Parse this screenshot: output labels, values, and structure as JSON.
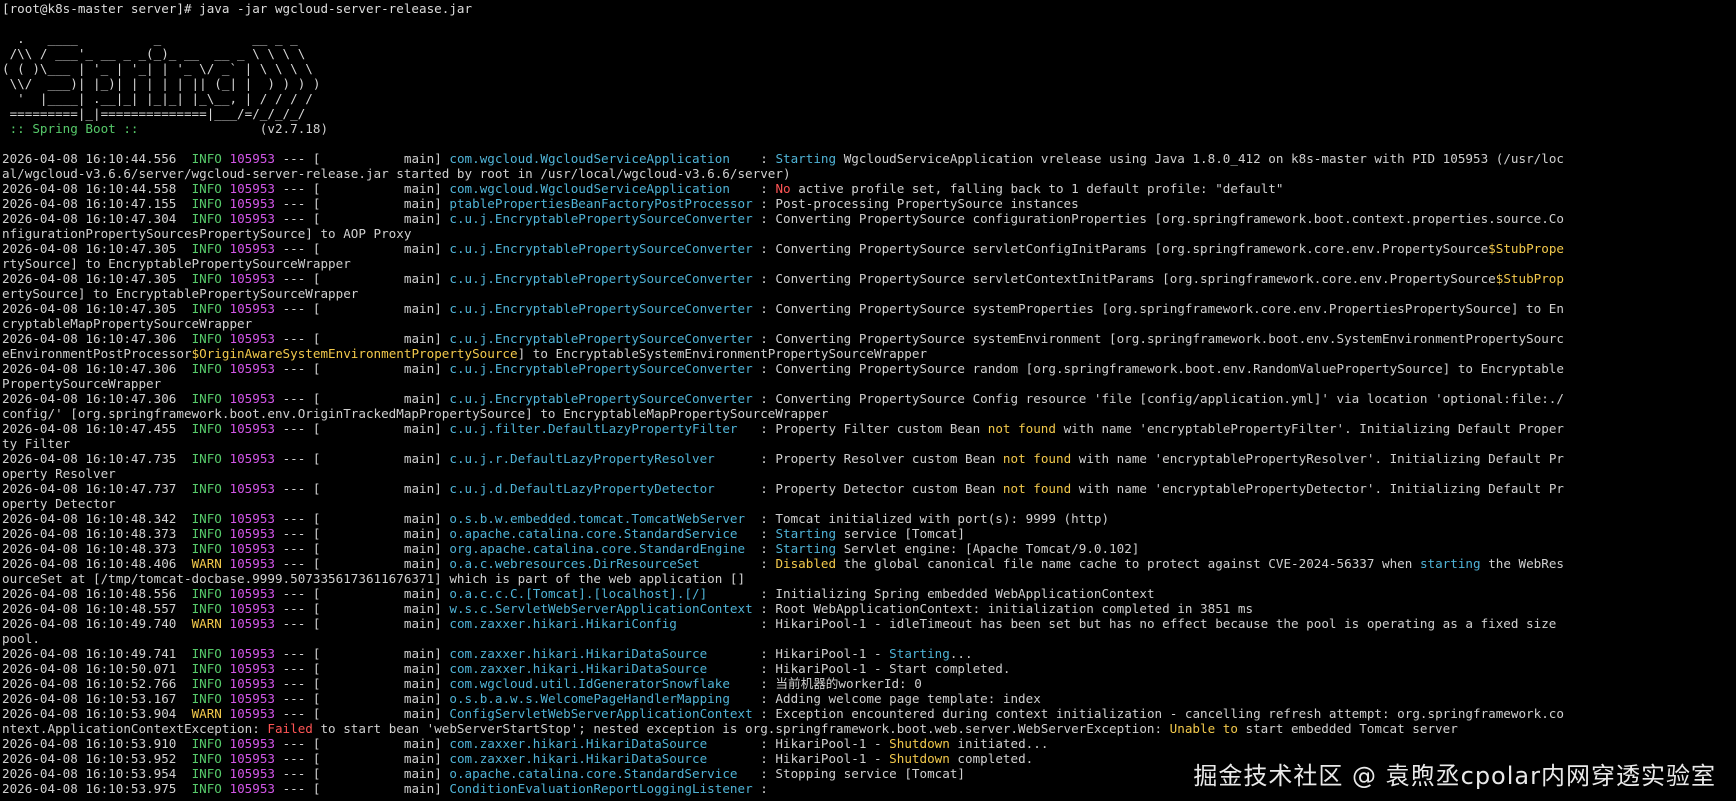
{
  "prompt": "[root@k8s-master server]# java -jar wgcloud-server-release.jar",
  "banner": [
    "  .   ____          _            __ _ _",
    " /\\\\ / ___'_ __ _ _(_)_ __  __ _ \\ \\ \\ \\",
    "( ( )\\___ | '_ | '_| | '_ \\/ _` | \\ \\ \\ \\",
    " \\\\/  ___)| |_)| | | | | || (_| |  ) ) ) )",
    "  '  |____| .__|_| |_|_| |_\\__, | / / / /",
    " =========|_|==============|___/=/_/_/_/"
  ],
  "spring_boot": {
    "label": " :: Spring Boot :: ",
    "version": "               (v2.7.18)"
  },
  "logs": [
    {
      "ts": "2026-04-08 16:10:44.556",
      "lvl": "INFO",
      "pid": "105953",
      "thread": " --- [           main] ",
      "logger": "com.wgcloud.WgcloudServiceApplication    ",
      "msg": [
        {
          "t": ": "
        },
        {
          "t": "Starting",
          "c": "cyan"
        },
        {
          "t": " WgcloudServiceApplication vrelease using Java 1.8.0_412 on k8s-master with PID 105953 (/usr/loc"
        }
      ],
      "cont": "al/wgcloud-v3.6.6/server/wgcloud-server-release.jar started by root in /usr/local/wgcloud-v3.6.6/server)"
    },
    {
      "ts": "2026-04-08 16:10:44.558",
      "lvl": "INFO",
      "pid": "105953",
      "thread": " --- [           main] ",
      "logger": "com.wgcloud.WgcloudServiceApplication    ",
      "msg": [
        {
          "t": ": "
        },
        {
          "t": "No",
          "c": "red"
        },
        {
          "t": " active profile set, falling back to 1 default profile: \"default\""
        }
      ]
    },
    {
      "ts": "2026-04-08 16:10:47.155",
      "lvl": "INFO",
      "pid": "105953",
      "thread": " --- [           main] ",
      "logger": "ptablePropertiesBeanFactoryPostProcessor ",
      "msg": [
        {
          "t": ": Post-processing PropertySource instances"
        }
      ]
    },
    {
      "ts": "2026-04-08 16:10:47.304",
      "lvl": "INFO",
      "pid": "105953",
      "thread": " --- [           main] ",
      "logger": "c.u.j.EncryptablePropertySourceConverter ",
      "msg": [
        {
          "t": ": Converting PropertySource configurationProperties [org.springframework.boot.context.properties.source.Co"
        }
      ],
      "cont": "nfigurationPropertySourcesPropertySource] to AOP Proxy"
    },
    {
      "ts": "2026-04-08 16:10:47.305",
      "lvl": "INFO",
      "pid": "105953",
      "thread": " --- [           main] ",
      "logger": "c.u.j.EncryptablePropertySourceConverter ",
      "msg": [
        {
          "t": ": Converting PropertySource servletConfigInitParams [org.springframework.core.env.PropertySource"
        },
        {
          "t": "$StubPrope",
          "c": "yel"
        }
      ],
      "cont": "rtySource] to EncryptablePropertySourceWrapper"
    },
    {
      "ts": "2026-04-08 16:10:47.305",
      "lvl": "INFO",
      "pid": "105953",
      "thread": " --- [           main] ",
      "logger": "c.u.j.EncryptablePropertySourceConverter ",
      "msg": [
        {
          "t": ": Converting PropertySource servletContextInitParams [org.springframework.core.env.PropertySource"
        },
        {
          "t": "$StubProp",
          "c": "yel"
        }
      ],
      "cont": "ertySource] to EncryptablePropertySourceWrapper"
    },
    {
      "ts": "2026-04-08 16:10:47.305",
      "lvl": "INFO",
      "pid": "105953",
      "thread": " --- [           main] ",
      "logger": "c.u.j.EncryptablePropertySourceConverter ",
      "msg": [
        {
          "t": ": Converting PropertySource systemProperties [org.springframework.core.env.PropertiesPropertySource] to En"
        }
      ],
      "cont": "cryptableMapPropertySourceWrapper"
    },
    {
      "ts": "2026-04-08 16:10:47.306",
      "lvl": "INFO",
      "pid": "105953",
      "thread": " --- [           main] ",
      "logger": "c.u.j.EncryptablePropertySourceConverter ",
      "msg": [
        {
          "t": ": Converting PropertySource systemEnvironment [org.springframework.boot.env.SystemEnvironmentPropertySourc"
        }
      ],
      "contParts": [
        {
          "t": "eEnvironmentPostProcessor"
        },
        {
          "t": "$OriginAwareSystemEnvironmentPropertySource",
          "c": "yel"
        },
        {
          "t": "] to EncryptableSystemEnvironmentPropertySourceWrapper"
        }
      ]
    },
    {
      "ts": "2026-04-08 16:10:47.306",
      "lvl": "INFO",
      "pid": "105953",
      "thread": " --- [           main] ",
      "logger": "c.u.j.EncryptablePropertySourceConverter ",
      "msg": [
        {
          "t": ": Converting PropertySource random [org.springframework.boot.env.RandomValuePropertySource] to Encryptable"
        }
      ],
      "cont": "PropertySourceWrapper"
    },
    {
      "ts": "2026-04-08 16:10:47.306",
      "lvl": "INFO",
      "pid": "105953",
      "thread": " --- [           main] ",
      "logger": "c.u.j.EncryptablePropertySourceConverter ",
      "msg": [
        {
          "t": ": Converting PropertySource Config resource 'file [config/application.yml]' via location 'optional:file:./"
        }
      ],
      "cont": "config/' [org.springframework.boot.env.OriginTrackedMapPropertySource] to EncryptableMapPropertySourceWrapper"
    },
    {
      "ts": "2026-04-08 16:10:47.455",
      "lvl": "INFO",
      "pid": "105953",
      "thread": " --- [           main] ",
      "logger": "c.u.j.filter.DefaultLazyPropertyFilter   ",
      "msg": [
        {
          "t": ": Property Filter custom Bean "
        },
        {
          "t": "not found",
          "c": "yel"
        },
        {
          "t": " with name 'encryptablePropertyFilter'. Initializing Default Proper"
        }
      ],
      "cont": "ty Filter"
    },
    {
      "ts": "2026-04-08 16:10:47.735",
      "lvl": "INFO",
      "pid": "105953",
      "thread": " --- [           main] ",
      "logger": "c.u.j.r.DefaultLazyPropertyResolver      ",
      "msg": [
        {
          "t": ": Property Resolver custom Bean "
        },
        {
          "t": "not found",
          "c": "yel"
        },
        {
          "t": " with name 'encryptablePropertyResolver'. Initializing Default Pr"
        }
      ],
      "cont": "operty Resolver"
    },
    {
      "ts": "2026-04-08 16:10:47.737",
      "lvl": "INFO",
      "pid": "105953",
      "thread": " --- [           main] ",
      "logger": "c.u.j.d.DefaultLazyPropertyDetector      ",
      "msg": [
        {
          "t": ": Property Detector custom Bean "
        },
        {
          "t": "not found",
          "c": "yel"
        },
        {
          "t": " with name 'encryptablePropertyDetector'. Initializing Default Pr"
        }
      ],
      "cont": "operty Detector"
    },
    {
      "ts": "2026-04-08 16:10:48.342",
      "lvl": "INFO",
      "pid": "105953",
      "thread": " --- [           main] ",
      "logger": "o.s.b.w.embedded.tomcat.TomcatWebServer  ",
      "msg": [
        {
          "t": ": Tomcat initialized with port(s): 9999 (http)"
        }
      ]
    },
    {
      "ts": "2026-04-08 16:10:48.373",
      "lvl": "INFO",
      "pid": "105953",
      "thread": " --- [           main] ",
      "logger": "o.apache.catalina.core.StandardService   ",
      "msg": [
        {
          "t": ": "
        },
        {
          "t": "Starting",
          "c": "cyan"
        },
        {
          "t": " service [Tomcat]"
        }
      ]
    },
    {
      "ts": "2026-04-08 16:10:48.373",
      "lvl": "INFO",
      "pid": "105953",
      "thread": " --- [           main] ",
      "logger": "org.apache.catalina.core.StandardEngine  ",
      "msg": [
        {
          "t": ": "
        },
        {
          "t": "Starting",
          "c": "cyan"
        },
        {
          "t": " Servlet engine: [Apache Tomcat/9.0.102]"
        }
      ]
    },
    {
      "ts": "2026-04-08 16:10:48.406",
      "lvl": "WARN",
      "pid": "105953",
      "thread": " --- [           main] ",
      "logger": "o.a.c.webresources.DirResourceSet        ",
      "msg": [
        {
          "t": ": "
        },
        {
          "t": "Disabled",
          "c": "yel"
        },
        {
          "t": " the global canonical file name cache to protect against CVE-2024-56337 when "
        },
        {
          "t": "starting",
          "c": "cyan"
        },
        {
          "t": " the WebRes"
        }
      ],
      "cont": "ourceSet at [/tmp/tomcat-docbase.9999.5073356173611676371] which is part of the web application []"
    },
    {
      "ts": "2026-04-08 16:10:48.556",
      "lvl": "INFO",
      "pid": "105953",
      "thread": " --- [           main] ",
      "logger": "o.a.c.c.C.[Tomcat].[localhost].[/]       ",
      "msg": [
        {
          "t": ": Initializing Spring embedded WebApplicationContext"
        }
      ]
    },
    {
      "ts": "2026-04-08 16:10:48.557",
      "lvl": "INFO",
      "pid": "105953",
      "thread": " --- [           main] ",
      "logger": "w.s.c.ServletWebServerApplicationContext ",
      "msg": [
        {
          "t": ": Root WebApplicationContext: initialization completed in 3851 ms"
        }
      ]
    },
    {
      "ts": "2026-04-08 16:10:49.740",
      "lvl": "WARN",
      "pid": "105953",
      "thread": " --- [           main] ",
      "logger": "com.zaxxer.hikari.HikariConfig           ",
      "msg": [
        {
          "t": ": HikariPool-1 - idleTimeout has been set but has no effect because the pool is operating as a fixed size"
        }
      ],
      "cont": "pool."
    },
    {
      "ts": "2026-04-08 16:10:49.741",
      "lvl": "INFO",
      "pid": "105953",
      "thread": " --- [           main] ",
      "logger": "com.zaxxer.hikari.HikariDataSource       ",
      "msg": [
        {
          "t": ": HikariPool-1 - "
        },
        {
          "t": "Starting",
          "c": "cyan"
        },
        {
          "t": "..."
        }
      ]
    },
    {
      "ts": "2026-04-08 16:10:50.071",
      "lvl": "INFO",
      "pid": "105953",
      "thread": " --- [           main] ",
      "logger": "com.zaxxer.hikari.HikariDataSource       ",
      "msg": [
        {
          "t": ": HikariPool-1 - Start completed."
        }
      ]
    },
    {
      "ts": "2026-04-08 16:10:52.766",
      "lvl": "INFO",
      "pid": "105953",
      "thread": " --- [           main] ",
      "logger": "com.wgcloud.util.IdGeneratorSnowflake    ",
      "msg": [
        {
          "t": ": 当前机器的workerId: 0"
        }
      ]
    },
    {
      "ts": "2026-04-08 16:10:53.167",
      "lvl": "INFO",
      "pid": "105953",
      "thread": " --- [           main] ",
      "logger": "o.s.b.a.w.s.WelcomePageHandlerMapping    ",
      "msg": [
        {
          "t": ": Adding welcome page template: index"
        }
      ]
    },
    {
      "ts": "2026-04-08 16:10:53.904",
      "lvl": "WARN",
      "pid": "105953",
      "thread": " --- [           main] ",
      "logger": "ConfigServletWebServerApplicationContext ",
      "msg": [
        {
          "t": ": Exception encountered during context initialization - cancelling refresh attempt: org.springframework.co"
        }
      ],
      "contParts": [
        {
          "t": "ntext.ApplicationContextException: "
        },
        {
          "t": "Failed",
          "c": "red"
        },
        {
          "t": " to start bean 'webServerStartStop'; nested exception is org.springframework.boot.web.server.WebServerException: "
        },
        {
          "t": "Unable to",
          "c": "yel"
        },
        {
          "t": " start embedded Tomcat server"
        }
      ]
    },
    {
      "ts": "2026-04-08 16:10:53.910",
      "lvl": "INFO",
      "pid": "105953",
      "thread": " --- [           main] ",
      "logger": "com.zaxxer.hikari.HikariDataSource       ",
      "msg": [
        {
          "t": ": HikariPool-1 - "
        },
        {
          "t": "Shutdown",
          "c": "yel"
        },
        {
          "t": " initiated..."
        }
      ]
    },
    {
      "ts": "2026-04-08 16:10:53.952",
      "lvl": "INFO",
      "pid": "105953",
      "thread": " --- [           main] ",
      "logger": "com.zaxxer.hikari.HikariDataSource       ",
      "msg": [
        {
          "t": ": HikariPool-1 - "
        },
        {
          "t": "Shutdown",
          "c": "yel"
        },
        {
          "t": " completed."
        }
      ]
    },
    {
      "ts": "2026-04-08 16:10:53.954",
      "lvl": "INFO",
      "pid": "105953",
      "thread": " --- [           main] ",
      "logger": "o.apache.catalina.core.StandardService   ",
      "msg": [
        {
          "t": ": Stopping service [Tomcat]"
        }
      ]
    },
    {
      "ts": "2026-04-08 16:10:53.975",
      "lvl": "INFO",
      "pid": "105953",
      "thread": " --- [           main] ",
      "logger": "ConditionEvaluationReportLoggingListener ",
      "msg": [
        {
          "t": ":"
        }
      ]
    }
  ],
  "watermark": "掘金技术社区 @ 袁煦丞cpolar内网穿透实验室",
  "colors": {
    "info": "#56c96a",
    "warn": "#f2c94c",
    "pid": "#d356e8",
    "logger": "#4fb3d6",
    "red": "#ff5555",
    "background": "#000000"
  }
}
